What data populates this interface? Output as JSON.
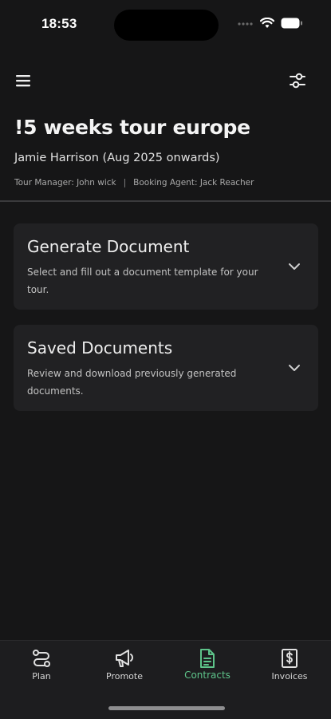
{
  "status_bar": {
    "time": "18:53"
  },
  "header": {
    "menu_icon": "hamburger-menu-icon",
    "filter_icon": "sliders-icon"
  },
  "tour": {
    "title": "!5 weeks tour europe",
    "artist_line": "Jamie Harrison (Aug 2025 onwards)",
    "tour_manager": "Tour Manager: John wick",
    "separator": "|",
    "booking_agent": "Booking Agent: Jack Reacher"
  },
  "cards": [
    {
      "title": "Generate Document",
      "description": "Select and fill out a document template for your tour."
    },
    {
      "title": "Saved Documents",
      "description": "Review and download previously generated documents."
    }
  ],
  "bottom_nav": {
    "items": [
      {
        "label": "Plan",
        "icon": "route-icon"
      },
      {
        "label": "Promote",
        "icon": "megaphone-icon"
      },
      {
        "label": "Contracts",
        "icon": "document-icon",
        "active": true
      },
      {
        "label": "Invoices",
        "icon": "dollar-receipt-icon"
      }
    ],
    "active_color": "#5ec48a"
  },
  "colors": {
    "background": "#161617",
    "card": "#212123",
    "accent": "#5ec48a"
  }
}
